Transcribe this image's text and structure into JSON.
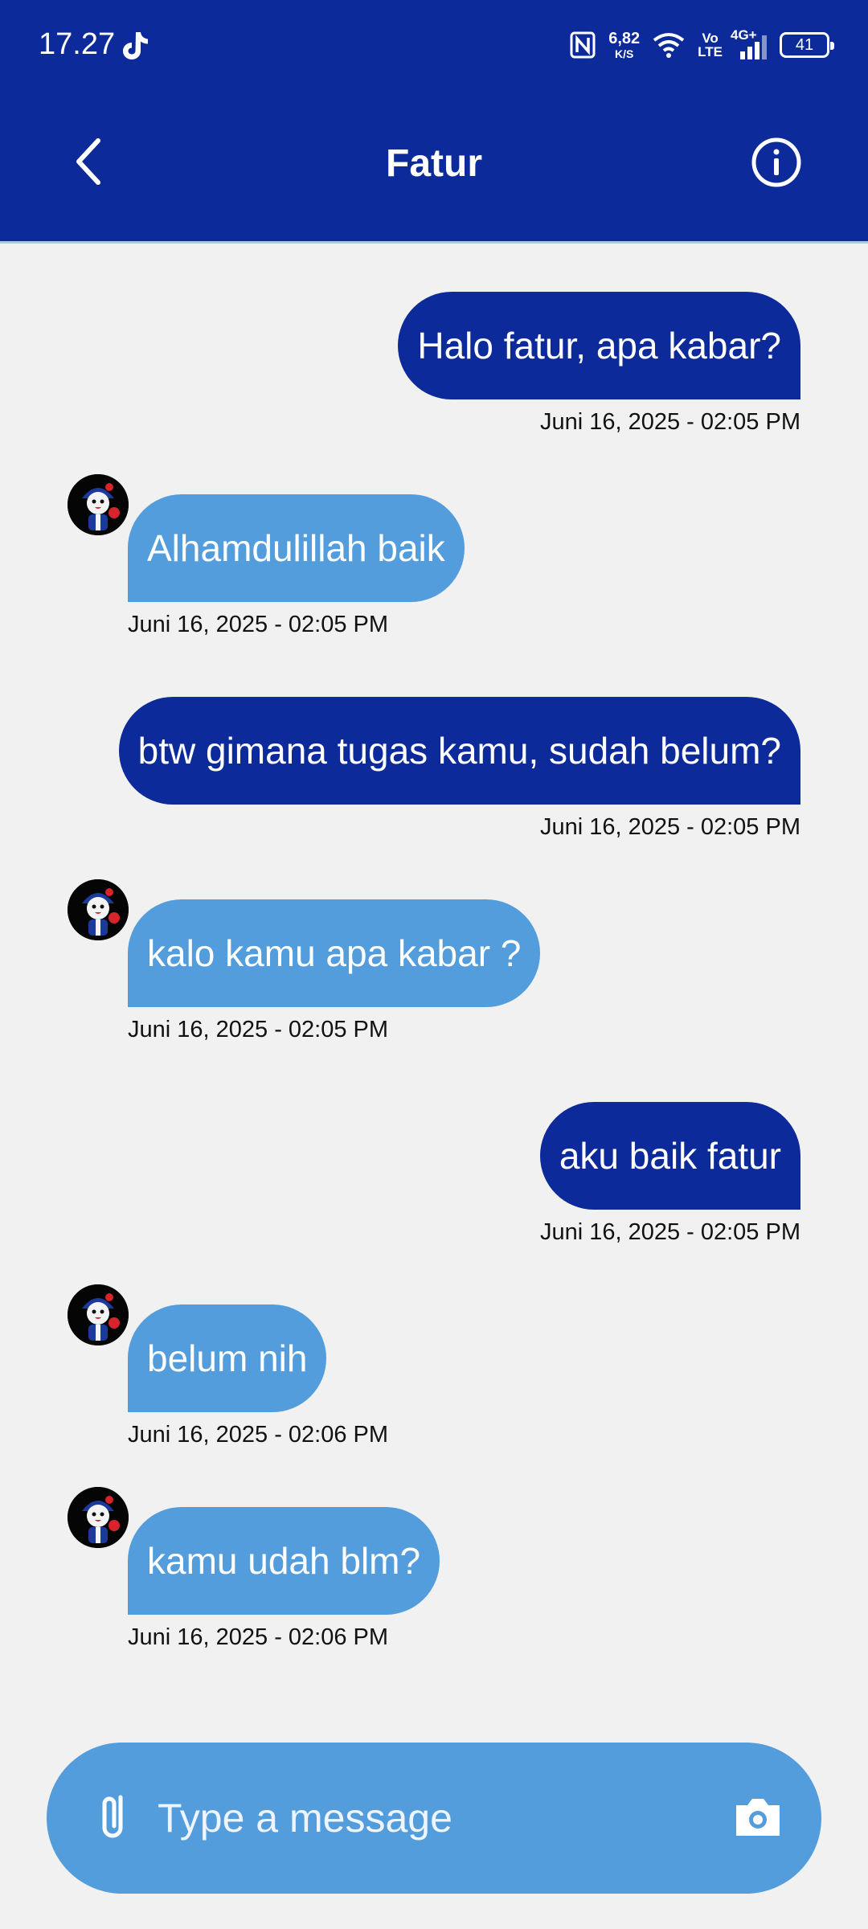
{
  "status_bar": {
    "time": "17.27",
    "speed_value": "6,82",
    "speed_unit": "K/S",
    "volte_top": "Vo",
    "volte_bottom": "LTE",
    "network": "4G+",
    "battery": "41"
  },
  "header": {
    "title": "Fatur",
    "back_icon": "chevron-left-icon",
    "info_icon": "info-icon"
  },
  "messages": [
    {
      "direction": "outgoing",
      "text": "Halo fatur, apa kabar?",
      "timestamp": "Juni 16, 2025 - 02:05 PM"
    },
    {
      "direction": "incoming",
      "text": "Alhamdulillah baik",
      "timestamp": "Juni 16, 2025 - 02:05 PM"
    },
    {
      "direction": "outgoing",
      "text": "btw gimana tugas kamu, sudah belum?",
      "timestamp": "Juni 16, 2025 - 02:05 PM"
    },
    {
      "direction": "incoming",
      "text": "kalo kamu apa kabar ?",
      "timestamp": "Juni 16, 2025 - 02:05 PM"
    },
    {
      "direction": "outgoing",
      "text": "aku baik fatur",
      "timestamp": "Juni 16, 2025 - 02:05 PM"
    },
    {
      "direction": "incoming",
      "text": "belum nih",
      "timestamp": "Juni 16, 2025 - 02:06 PM"
    },
    {
      "direction": "incoming",
      "text": "kamu udah blm?",
      "timestamp": "Juni 16, 2025 - 02:06 PM"
    }
  ],
  "composer": {
    "placeholder": "Type a message",
    "attach_icon": "paperclip-icon",
    "camera_icon": "camera-icon"
  },
  "colors": {
    "app_bar": "#0c2a99",
    "outgoing_bubble": "#0c2a99",
    "incoming_bubble": "#539ddc",
    "background": "#f1f1f1"
  }
}
